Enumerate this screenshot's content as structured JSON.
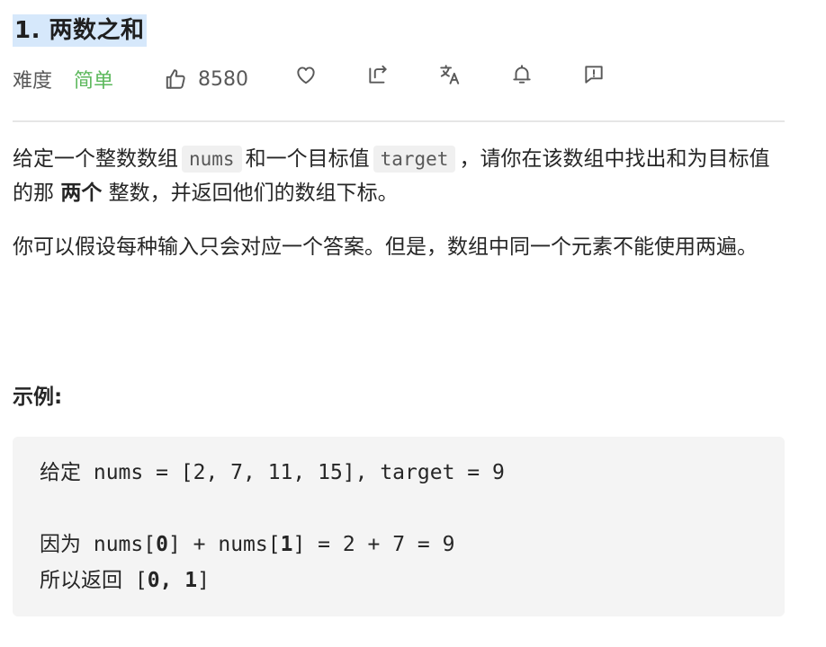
{
  "problem": {
    "title": "1. 两数之和",
    "difficulty_label": "难度",
    "difficulty_value": "简单",
    "likes": "8580"
  },
  "icons": [
    "thumbs-up-icon",
    "heart-icon",
    "share-icon",
    "translate-icon",
    "bell-icon",
    "feedback-icon"
  ],
  "colors": {
    "title_highlight": "#d6e8fb",
    "difficulty_easy": "#5cb85c",
    "code_bg": "#f4f4f4",
    "inline_code_bg": "#f0f0f0"
  },
  "description": {
    "p1_a": "给定一个整数数组",
    "p1_code1": "nums",
    "p1_b": "和一个目标值",
    "p1_code2": "target",
    "p1_c": "，请你在该数组中找出和为目标值的那",
    "p1_strong": "两个",
    "p1_d": "整数，并返回他们的数组下标。",
    "p2": "你可以假设每种输入只会对应一个答案。但是，数组中同一个元素不能使用两遍。"
  },
  "example": {
    "heading": "示例:",
    "line1": "给定 nums = [2, 7, 11, 15], target = 9",
    "line3_a": "因为 nums[",
    "line3_b": "0",
    "line3_c": "] + nums[",
    "line3_d": "1",
    "line3_e": "] = 2 + 7 = 9",
    "line4_a": "所以返回 [",
    "line4_b": "0, 1",
    "line4_c": "]"
  }
}
